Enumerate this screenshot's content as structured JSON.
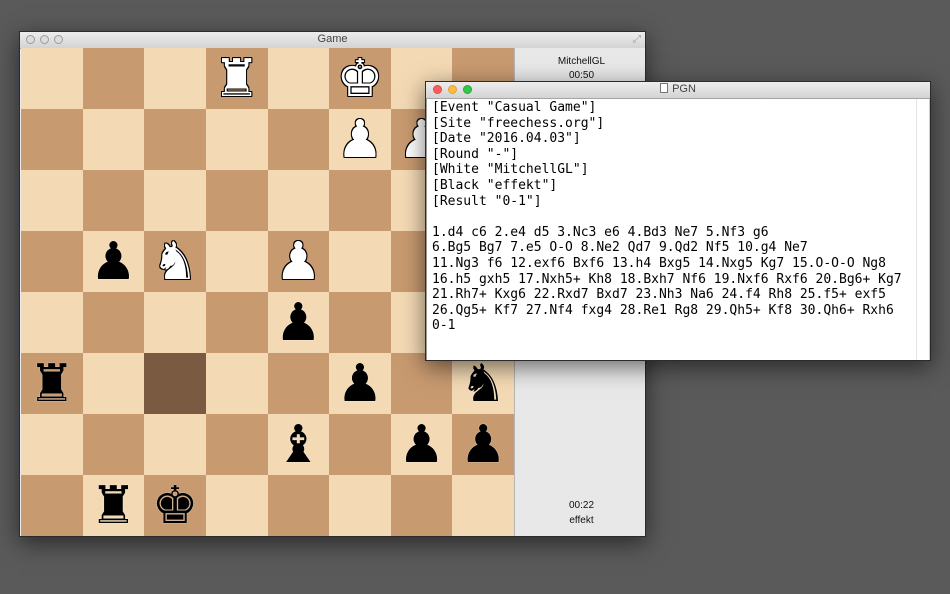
{
  "game_window": {
    "title": "Game",
    "white_player": {
      "name": "MitchellGL",
      "clock": "00:50"
    },
    "black_player": {
      "name": "effekt",
      "clock": "00:22"
    },
    "board": {
      "light_color": "#f4dab4",
      "dark_color": "#c89a70",
      "highlight_color": "#7a5b42",
      "highlighted_squares": [
        "c3"
      ],
      "pieces": [
        {
          "square": "d8",
          "type": "rook",
          "color": "white",
          "glyph": "♜"
        },
        {
          "square": "f8",
          "type": "king",
          "color": "white",
          "glyph": "♚"
        },
        {
          "square": "f7",
          "type": "pawn",
          "color": "white",
          "glyph": "♟"
        },
        {
          "square": "g7",
          "type": "pawn",
          "color": "white",
          "glyph": "♟"
        },
        {
          "square": "b5",
          "type": "pawn",
          "color": "black",
          "glyph": "♟"
        },
        {
          "square": "c5",
          "type": "knight",
          "color": "white",
          "glyph": "♞"
        },
        {
          "square": "e5",
          "type": "pawn",
          "color": "white",
          "glyph": "♟"
        },
        {
          "square": "e4",
          "type": "pawn",
          "color": "black",
          "glyph": "♟"
        },
        {
          "square": "a3",
          "type": "rook",
          "color": "black",
          "glyph": "♜"
        },
        {
          "square": "f3",
          "type": "pawn",
          "color": "black",
          "glyph": "♟"
        },
        {
          "square": "h3",
          "type": "knight",
          "color": "black",
          "glyph": "♞"
        },
        {
          "square": "e2",
          "type": "bishop",
          "color": "black",
          "glyph": "♝"
        },
        {
          "square": "g2",
          "type": "pawn",
          "color": "black",
          "glyph": "♟"
        },
        {
          "square": "h2",
          "type": "pawn",
          "color": "black",
          "glyph": "♟"
        },
        {
          "square": "b1",
          "type": "rook",
          "color": "black",
          "glyph": "♜"
        },
        {
          "square": "c1",
          "type": "king",
          "color": "black",
          "glyph": "♚"
        }
      ]
    }
  },
  "pgn_window": {
    "title": "PGN",
    "lines": [
      "[Event \"Casual Game\"]",
      "[Site \"freechess.org\"]",
      "[Date \"2016.04.03\"]",
      "[Round \"-\"]",
      "[White \"MitchellGL\"]",
      "[Black \"effekt\"]",
      "[Result \"0-1\"]",
      "",
      "1.d4 c6 2.e4 d5 3.Nc3 e6 4.Bd3 Ne7 5.Nf3 g6",
      "6.Bg5 Bg7 7.e5 O-O 8.Ne2 Qd7 9.Qd2 Nf5 10.g4 Ne7",
      "11.Ng3 f6 12.exf6 Bxf6 13.h4 Bxg5 14.Nxg5 Kg7 15.O-O-O Ng8",
      "16.h5 gxh5 17.Nxh5+ Kh8 18.Bxh7 Nf6 19.Nxf6 Rxf6 20.Bg6+ Kg7",
      "21.Rh7+ Kxg6 22.Rxd7 Bxd7 23.Nh3 Na6 24.f4 Rh8 25.f5+ exf5",
      "26.Qg5+ Kf7 27.Nf4 fxg4 28.Re1 Rg8 29.Qh5+ Kf8 30.Qh6+ Rxh6",
      "0-1"
    ]
  }
}
